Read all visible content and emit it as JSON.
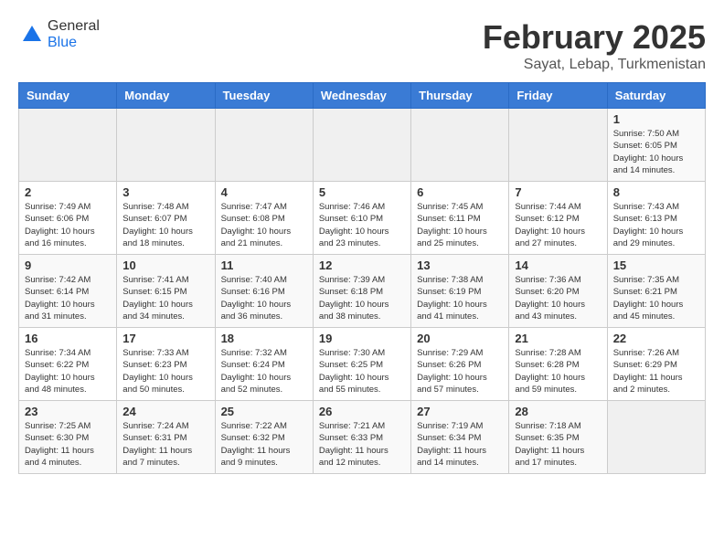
{
  "header": {
    "logo_general": "General",
    "logo_blue": "Blue",
    "title": "February 2025",
    "subtitle": "Sayat, Lebap, Turkmenistan"
  },
  "weekdays": [
    "Sunday",
    "Monday",
    "Tuesday",
    "Wednesday",
    "Thursday",
    "Friday",
    "Saturday"
  ],
  "weeks": [
    [
      {
        "day": "",
        "info": ""
      },
      {
        "day": "",
        "info": ""
      },
      {
        "day": "",
        "info": ""
      },
      {
        "day": "",
        "info": ""
      },
      {
        "day": "",
        "info": ""
      },
      {
        "day": "",
        "info": ""
      },
      {
        "day": "1",
        "info": "Sunrise: 7:50 AM\nSunset: 6:05 PM\nDaylight: 10 hours\nand 14 minutes."
      }
    ],
    [
      {
        "day": "2",
        "info": "Sunrise: 7:49 AM\nSunset: 6:06 PM\nDaylight: 10 hours\nand 16 minutes."
      },
      {
        "day": "3",
        "info": "Sunrise: 7:48 AM\nSunset: 6:07 PM\nDaylight: 10 hours\nand 18 minutes."
      },
      {
        "day": "4",
        "info": "Sunrise: 7:47 AM\nSunset: 6:08 PM\nDaylight: 10 hours\nand 21 minutes."
      },
      {
        "day": "5",
        "info": "Sunrise: 7:46 AM\nSunset: 6:10 PM\nDaylight: 10 hours\nand 23 minutes."
      },
      {
        "day": "6",
        "info": "Sunrise: 7:45 AM\nSunset: 6:11 PM\nDaylight: 10 hours\nand 25 minutes."
      },
      {
        "day": "7",
        "info": "Sunrise: 7:44 AM\nSunset: 6:12 PM\nDaylight: 10 hours\nand 27 minutes."
      },
      {
        "day": "8",
        "info": "Sunrise: 7:43 AM\nSunset: 6:13 PM\nDaylight: 10 hours\nand 29 minutes."
      }
    ],
    [
      {
        "day": "9",
        "info": "Sunrise: 7:42 AM\nSunset: 6:14 PM\nDaylight: 10 hours\nand 31 minutes."
      },
      {
        "day": "10",
        "info": "Sunrise: 7:41 AM\nSunset: 6:15 PM\nDaylight: 10 hours\nand 34 minutes."
      },
      {
        "day": "11",
        "info": "Sunrise: 7:40 AM\nSunset: 6:16 PM\nDaylight: 10 hours\nand 36 minutes."
      },
      {
        "day": "12",
        "info": "Sunrise: 7:39 AM\nSunset: 6:18 PM\nDaylight: 10 hours\nand 38 minutes."
      },
      {
        "day": "13",
        "info": "Sunrise: 7:38 AM\nSunset: 6:19 PM\nDaylight: 10 hours\nand 41 minutes."
      },
      {
        "day": "14",
        "info": "Sunrise: 7:36 AM\nSunset: 6:20 PM\nDaylight: 10 hours\nand 43 minutes."
      },
      {
        "day": "15",
        "info": "Sunrise: 7:35 AM\nSunset: 6:21 PM\nDaylight: 10 hours\nand 45 minutes."
      }
    ],
    [
      {
        "day": "16",
        "info": "Sunrise: 7:34 AM\nSunset: 6:22 PM\nDaylight: 10 hours\nand 48 minutes."
      },
      {
        "day": "17",
        "info": "Sunrise: 7:33 AM\nSunset: 6:23 PM\nDaylight: 10 hours\nand 50 minutes."
      },
      {
        "day": "18",
        "info": "Sunrise: 7:32 AM\nSunset: 6:24 PM\nDaylight: 10 hours\nand 52 minutes."
      },
      {
        "day": "19",
        "info": "Sunrise: 7:30 AM\nSunset: 6:25 PM\nDaylight: 10 hours\nand 55 minutes."
      },
      {
        "day": "20",
        "info": "Sunrise: 7:29 AM\nSunset: 6:26 PM\nDaylight: 10 hours\nand 57 minutes."
      },
      {
        "day": "21",
        "info": "Sunrise: 7:28 AM\nSunset: 6:28 PM\nDaylight: 10 hours\nand 59 minutes."
      },
      {
        "day": "22",
        "info": "Sunrise: 7:26 AM\nSunset: 6:29 PM\nDaylight: 11 hours\nand 2 minutes."
      }
    ],
    [
      {
        "day": "23",
        "info": "Sunrise: 7:25 AM\nSunset: 6:30 PM\nDaylight: 11 hours\nand 4 minutes."
      },
      {
        "day": "24",
        "info": "Sunrise: 7:24 AM\nSunset: 6:31 PM\nDaylight: 11 hours\nand 7 minutes."
      },
      {
        "day": "25",
        "info": "Sunrise: 7:22 AM\nSunset: 6:32 PM\nDaylight: 11 hours\nand 9 minutes."
      },
      {
        "day": "26",
        "info": "Sunrise: 7:21 AM\nSunset: 6:33 PM\nDaylight: 11 hours\nand 12 minutes."
      },
      {
        "day": "27",
        "info": "Sunrise: 7:19 AM\nSunset: 6:34 PM\nDaylight: 11 hours\nand 14 minutes."
      },
      {
        "day": "28",
        "info": "Sunrise: 7:18 AM\nSunset: 6:35 PM\nDaylight: 11 hours\nand 17 minutes."
      },
      {
        "day": "",
        "info": ""
      }
    ]
  ]
}
